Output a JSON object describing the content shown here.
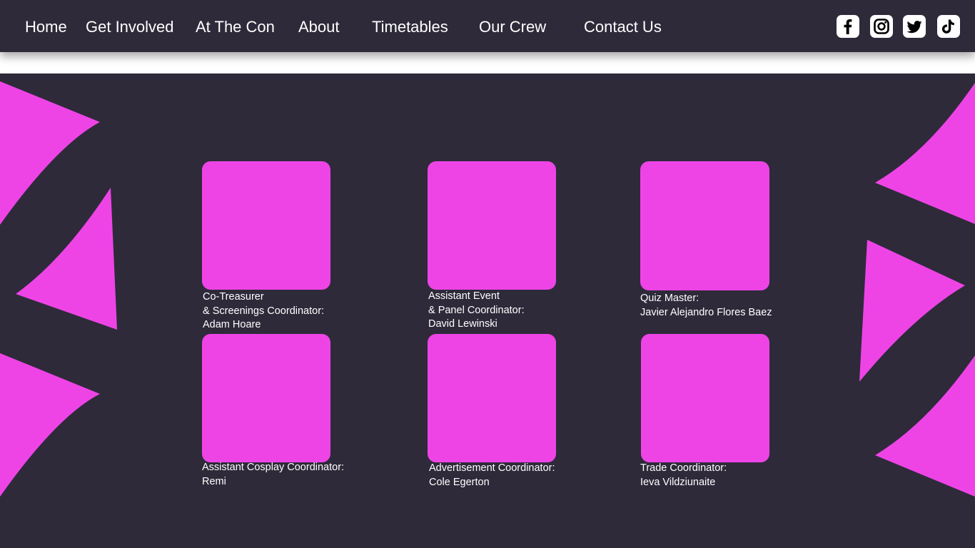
{
  "nav": {
    "items": [
      {
        "label": "Home"
      },
      {
        "label": "Get Involved"
      },
      {
        "label": "At The Con"
      },
      {
        "label": "About"
      },
      {
        "label": "Timetables"
      },
      {
        "label": "Our Crew"
      },
      {
        "label": "Contact Us"
      }
    ]
  },
  "social": {
    "icons": [
      "facebook-icon",
      "instagram-icon",
      "twitter-icon",
      "tiktok-icon"
    ]
  },
  "colors": {
    "background": "#2e2a3a",
    "accent": "#ee44e6",
    "text": "#ffffff"
  },
  "crew": [
    {
      "lines": [
        "Co-Treasurer",
        "& Screenings Coordinator:",
        "Adam Hoare"
      ]
    },
    {
      "lines": [
        "Assistant Event",
        "& Panel Coordinator:",
        "David Lewinski"
      ]
    },
    {
      "lines": [
        "Quiz Master:",
        "Javier Alejandro Flores Baez"
      ]
    },
    {
      "lines": [
        "Assistant Cosplay Coordinator:",
        "Remi"
      ]
    },
    {
      "lines": [
        "Advertisement Coordinator:",
        "Cole Egerton"
      ]
    },
    {
      "lines": [
        "Trade Coordinator:",
        "Ieva Vildziunaite"
      ]
    }
  ]
}
